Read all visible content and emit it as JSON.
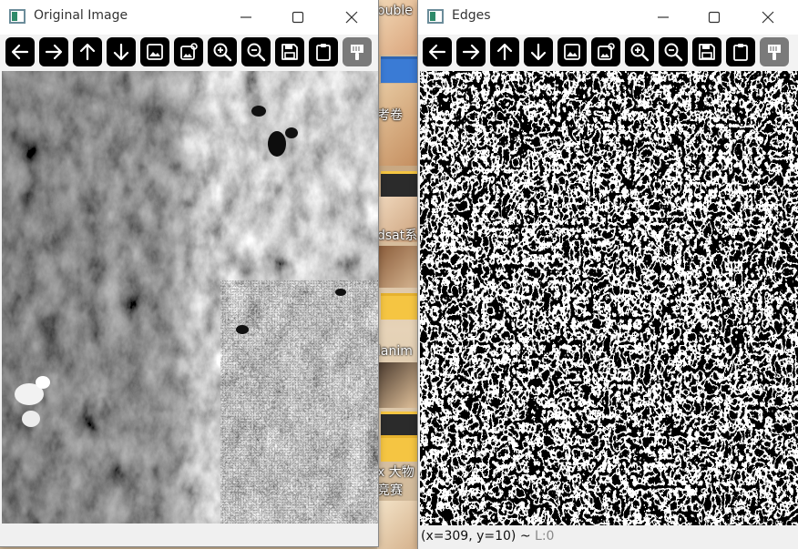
{
  "windows": {
    "left": {
      "title": "Original Image",
      "status": ""
    },
    "right": {
      "title": "Edges",
      "status_coords": "(x=309, y=10) ~ ",
      "status_level": "L:0"
    }
  },
  "toolbar_icons": [
    "arrow-left-icon",
    "arrow-right-icon",
    "arrow-up-icon",
    "arrow-down-icon",
    "image-icon",
    "image-settings-icon",
    "zoom-in-icon",
    "zoom-out-icon",
    "save-icon",
    "clipboard-icon",
    "properties-icon"
  ],
  "desktop_labels": {
    "item1": "ouble",
    "item2": "考卷",
    "item3": "dsat系",
    "item4": "lanim",
    "item5": "x 大物",
    "item6": "竞赛"
  },
  "colors": {
    "tool_bg": "#000000",
    "tool_disabled_bg": "#7a7a7a",
    "titlebar_bg": "#ffffff",
    "status_muted": "#8a8a8a"
  }
}
